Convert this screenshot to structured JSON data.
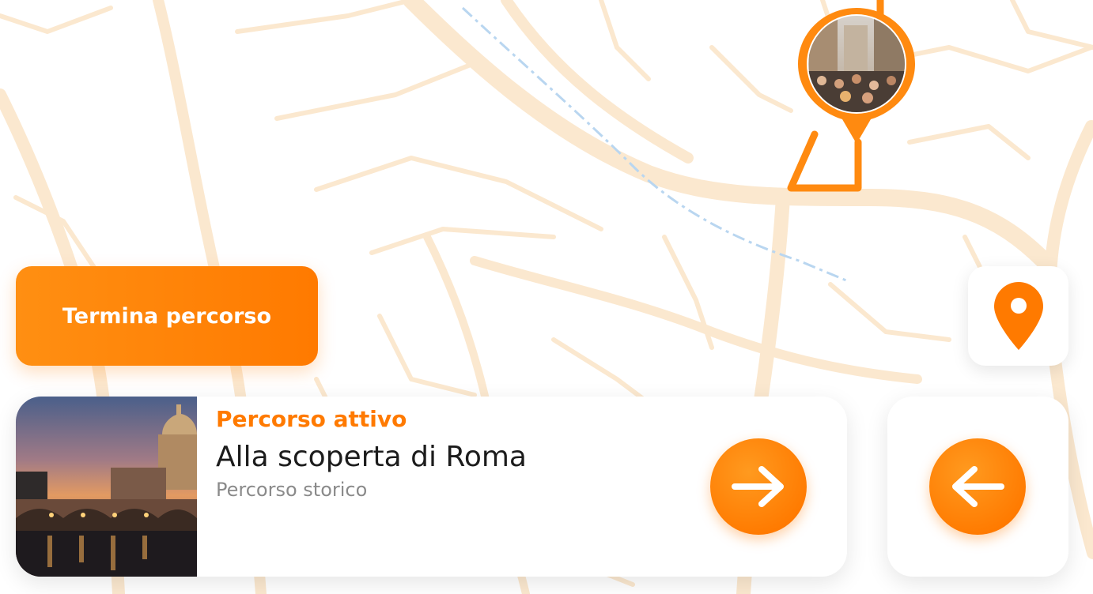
{
  "map": {
    "road_color": "#fbe8cf",
    "route_color": "#ff8a10",
    "river_color": "#b9d6f0"
  },
  "actions": {
    "end_route_label": "Termina percorso",
    "location_icon": "location-pin-icon"
  },
  "active_route": {
    "kicker": "Percorso attivo",
    "title": "Alla scoperta di Roma",
    "subtitle": "Percorso storico",
    "next_icon": "arrow-right-icon",
    "back_icon": "arrow-left-icon"
  },
  "colors": {
    "accent": "#ff7a00",
    "text_dark": "#1c1c1c",
    "text_muted": "#8a8a8a"
  }
}
